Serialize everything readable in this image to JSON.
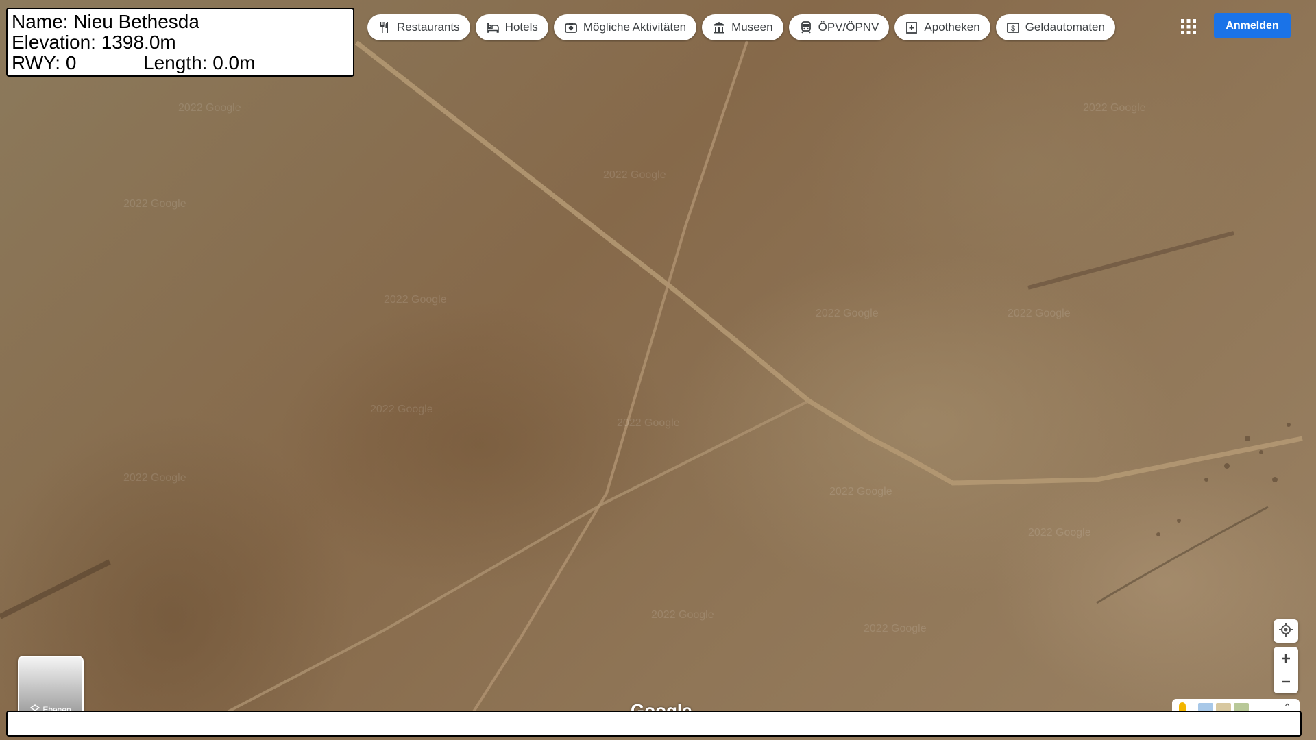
{
  "info_panel": {
    "name_line": "Name: Nieu Bethesda",
    "elevation_line": "Elevation: 1398.0m",
    "rwy_line": "RWY: 0",
    "length_line": "Length: 0.0m"
  },
  "categories": [
    {
      "label": "Restaurants",
      "icon": "fork-knife-icon"
    },
    {
      "label": "Hotels",
      "icon": "bed-icon"
    },
    {
      "label": "Mögliche Aktivitäten",
      "icon": "camera-icon"
    },
    {
      "label": "Museen",
      "icon": "museum-icon"
    },
    {
      "label": "ÖPV/ÖPNV",
      "icon": "train-icon"
    },
    {
      "label": "Apotheken",
      "icon": "pharmacy-icon"
    },
    {
      "label": "Geldautomaten",
      "icon": "atm-icon"
    }
  ],
  "header": {
    "apps_icon": "apps-grid-icon",
    "signin_label": "Anmelden",
    "accent_color": "#1a73e8"
  },
  "map": {
    "layer_label": "Ebenen",
    "logo_text": "Google",
    "watermark": "2022 Google"
  },
  "bottom_bar": {
    "text": ""
  }
}
